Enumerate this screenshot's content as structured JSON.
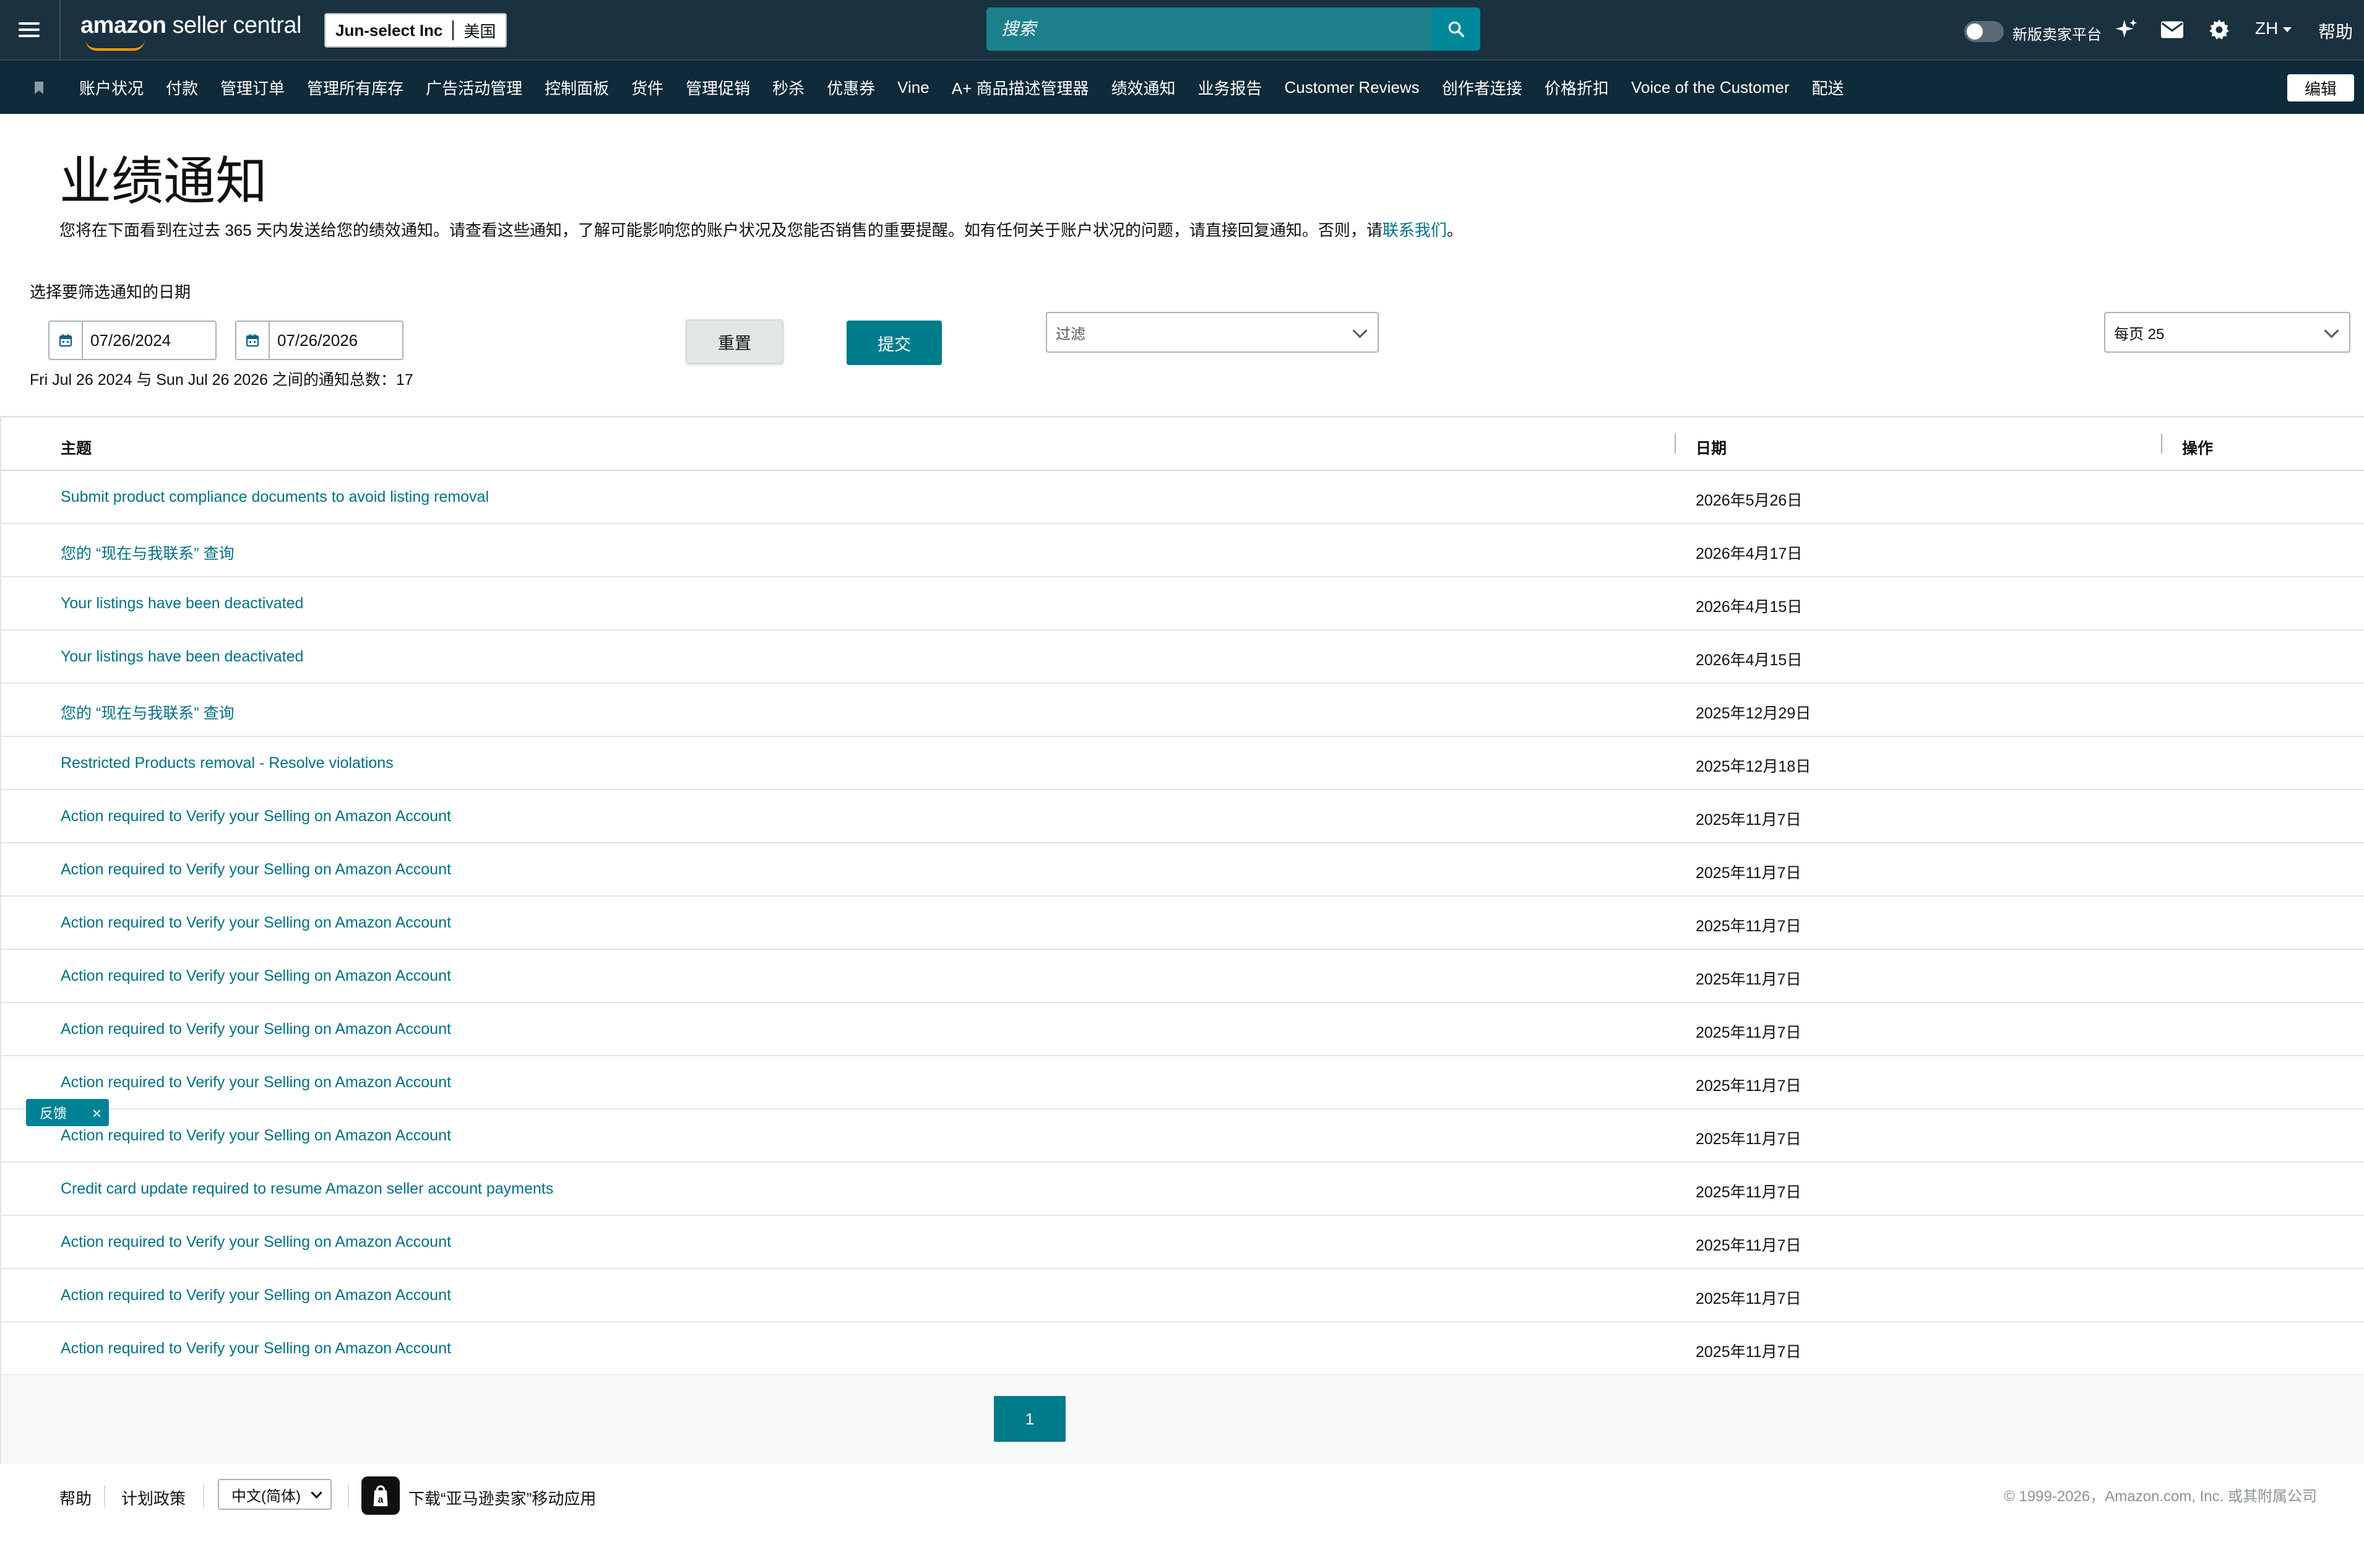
{
  "header": {
    "brand_main": "amazon",
    "brand_sub": " seller central",
    "account_name": "Jun-select Inc",
    "account_market": "美国",
    "search_placeholder": "搜索",
    "toggle_label": "新版卖家平台",
    "language": "ZH",
    "help": "帮助",
    "icons": [
      "menu-icon",
      "search-icon",
      "sparkle-icon",
      "mail-icon",
      "gear-icon"
    ]
  },
  "nav": {
    "items": [
      "账户状况",
      "付款",
      "管理订单",
      "管理所有库存",
      "广告活动管理",
      "控制面板",
      "货件",
      "管理促销",
      "秒杀",
      "优惠券",
      "Vine",
      "A+ 商品描述管理器",
      "绩效通知",
      "业务报告",
      "Customer Reviews",
      "创作者连接",
      "价格折扣",
      "Voice of the Customer",
      "配送"
    ],
    "edit_label": "编辑"
  },
  "page": {
    "title": "业绩通知",
    "description": "您将在下面看到在过去 365 天内发送给您的绩效通知。请查看这些通知，了解可能影响您的账户状况及您能否销售的重要提醒。如有任何关于账户状况的问题，请直接回复通知。否则，请",
    "contact_link": "联系我们",
    "description_end": "。",
    "date_filter_label": "选择要筛选通知的日期",
    "start_date": "07/26/2024",
    "end_date": "07/26/2026",
    "reset_label": "重置",
    "submit_label": "提交",
    "filter_placeholder": "过滤",
    "per_page": "每页 25",
    "count_text": "Fri Jul 26 2024 与 Sun Jul 26 2026 之间的通知总数：17"
  },
  "table": {
    "headers": {
      "subject": "主题",
      "date": "日期",
      "action": "操作"
    },
    "rows": [
      {
        "subject": "Submit product compliance documents to avoid listing removal",
        "date": "2026年5月26日"
      },
      {
        "subject": "您的 “现在与我联系” 查询",
        "date": "2026年4月17日"
      },
      {
        "subject": "Your listings have been deactivated",
        "date": "2026年4月15日"
      },
      {
        "subject": "Your listings have been deactivated",
        "date": "2026年4月15日"
      },
      {
        "subject": "您的 “现在与我联系” 查询",
        "date": "2025年12月29日"
      },
      {
        "subject": "Restricted Products removal - Resolve violations",
        "date": "2025年12月18日"
      },
      {
        "subject": "Action required to Verify your Selling on Amazon Account",
        "date": "2025年11月7日"
      },
      {
        "subject": "Action required to Verify your Selling on Amazon Account",
        "date": "2025年11月7日"
      },
      {
        "subject": "Action required to Verify your Selling on Amazon Account",
        "date": "2025年11月7日"
      },
      {
        "subject": "Action required to Verify your Selling on Amazon Account",
        "date": "2025年11月7日"
      },
      {
        "subject": "Action required to Verify your Selling on Amazon Account",
        "date": "2025年11月7日"
      },
      {
        "subject": "Action required to Verify your Selling on Amazon Account",
        "date": "2025年11月7日"
      },
      {
        "subject": "Action required to Verify your Selling on Amazon Account",
        "date": "2025年11月7日"
      },
      {
        "subject": "Credit card update required to resume Amazon seller account payments",
        "date": "2025年11月7日"
      },
      {
        "subject": "Action required to Verify your Selling on Amazon Account",
        "date": "2025年11月7日"
      },
      {
        "subject": "Action required to Verify your Selling on Amazon Account",
        "date": "2025年11月7日"
      },
      {
        "subject": "Action required to Verify your Selling on Amazon Account",
        "date": "2025年11月7日"
      }
    ]
  },
  "pagination": {
    "current_page": "1"
  },
  "feedback": {
    "label": "反馈",
    "close": "×"
  },
  "footer": {
    "help": "帮助",
    "policies": "计划政策",
    "language": "中文(简体)",
    "app_text": "下载“亚马逊卖家”移动应用",
    "copyright": "© 1999-2026，Amazon.com, Inc. 或其附属公司"
  },
  "colors": {
    "header_bg": "#1a3140",
    "nav_bg": "#0f2a38",
    "accent": "#007b8a",
    "link": "#007185",
    "brand_orange": "#ff9900"
  }
}
